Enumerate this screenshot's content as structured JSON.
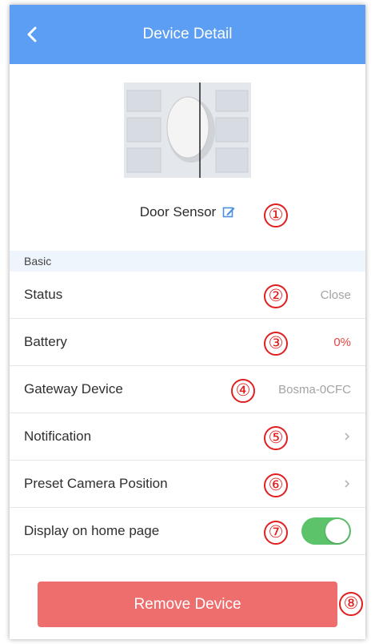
{
  "header": {
    "title": "Device Detail",
    "back_icon": "chevron-left-icon"
  },
  "device": {
    "name": "Door Sensor",
    "edit_icon": "edit-icon"
  },
  "section": {
    "label": "Basic"
  },
  "rows": [
    {
      "label": "Status",
      "value": "Close"
    },
    {
      "label": "Battery",
      "value": "0%"
    },
    {
      "label": "Gateway Device",
      "value": "Bosma-0CFC"
    },
    {
      "label": "Notification",
      "value": ""
    },
    {
      "label": "Preset Camera Position",
      "value": ""
    },
    {
      "label": "Display on home page",
      "toggle_on": true
    }
  ],
  "remove_button": {
    "label": "Remove Device"
  },
  "annotations": [
    "①",
    "②",
    "③",
    "④",
    "⑤",
    "⑥",
    "⑦",
    "⑧"
  ],
  "colors": {
    "header": "#5b9ef4",
    "toggle_on": "#5cc36b",
    "remove": "#ee6e6e",
    "annotation": "#e02020",
    "battery_value": "#e84545"
  }
}
